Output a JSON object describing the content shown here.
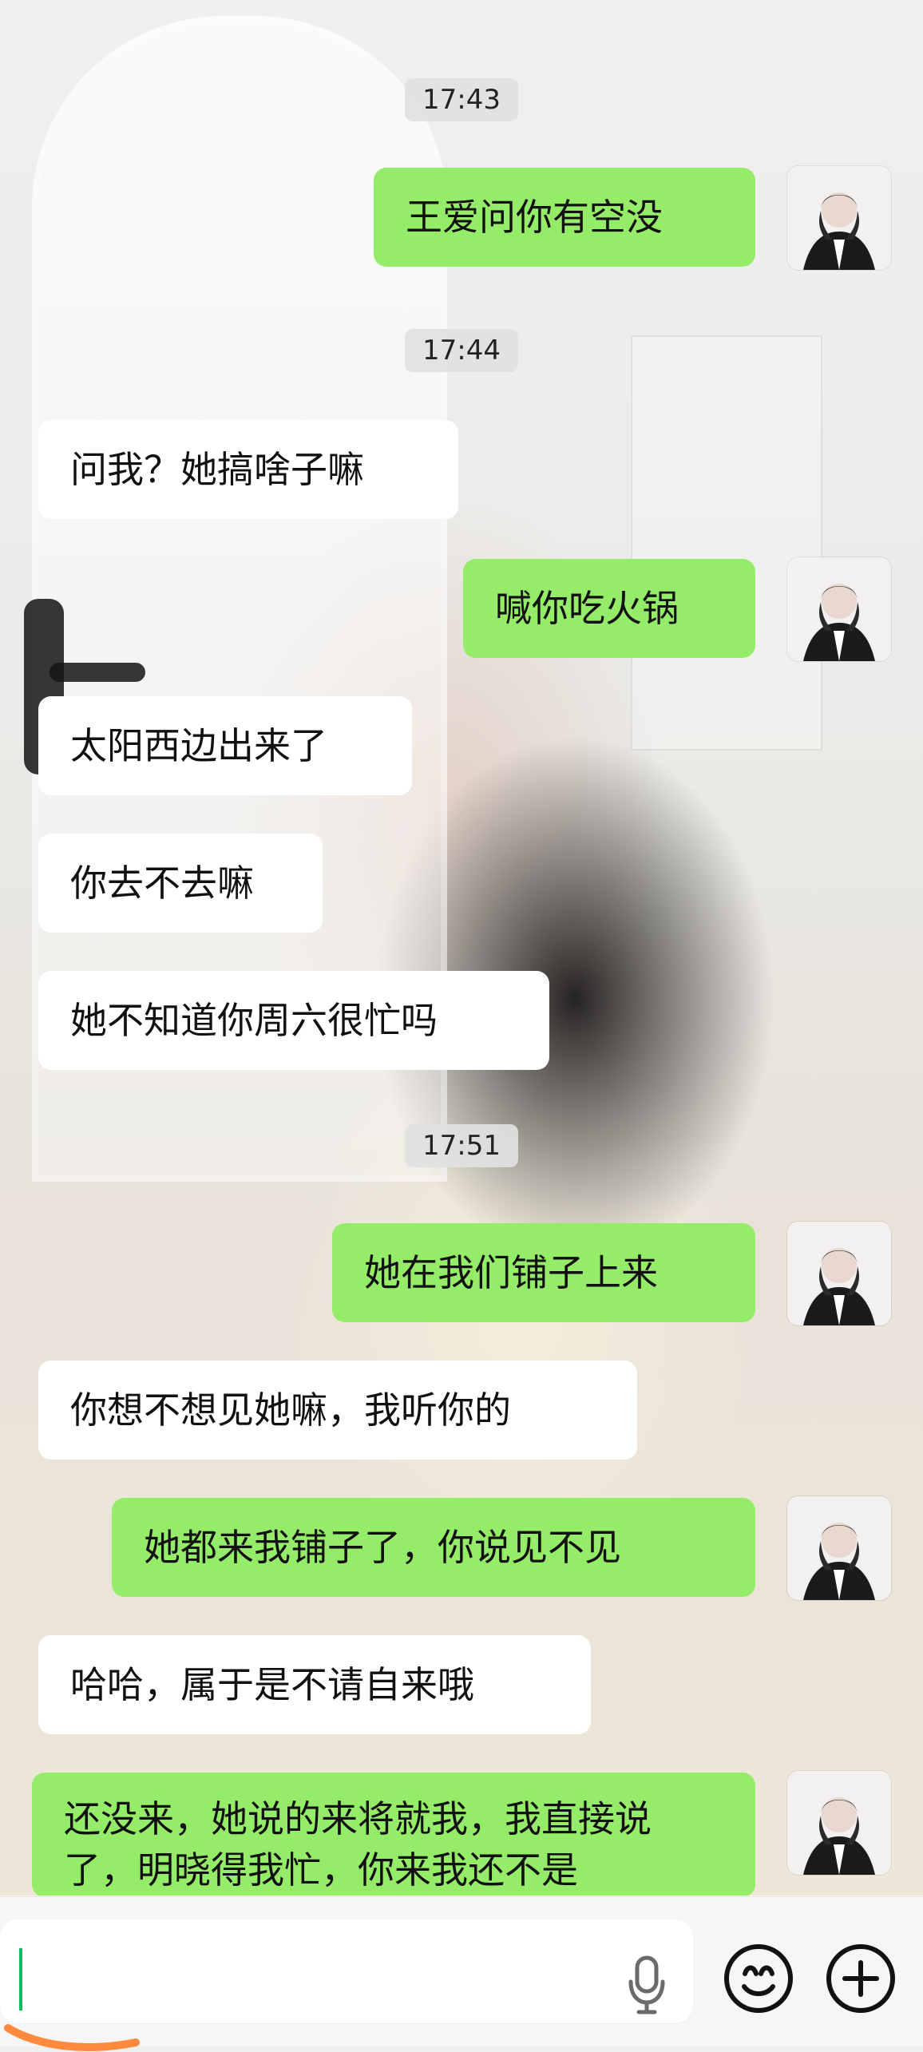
{
  "chat": {
    "timestamps": [
      "17:43",
      "17:44",
      "17:51"
    ],
    "messages": [
      {
        "side": "right",
        "text": "王爱问你有空没"
      },
      {
        "side": "left",
        "text": "问我？她搞啥子嘛"
      },
      {
        "side": "right",
        "text": "喊你吃火锅"
      },
      {
        "side": "left",
        "text": "太阳西边出来了"
      },
      {
        "side": "left",
        "text": "你去不去嘛"
      },
      {
        "side": "left",
        "text": "她不知道你周六很忙吗"
      },
      {
        "side": "right",
        "text": "她在我们铺子上来"
      },
      {
        "side": "left",
        "text": "你想不想见她嘛，我听你的"
      },
      {
        "side": "right",
        "text": "她都来我铺子了，你说见不见"
      },
      {
        "side": "left",
        "text": "哈哈，属于是不请自来哦"
      },
      {
        "side": "right",
        "text": "还没来，她说的来将就我，我直接说了，明晓得我忙，你来我还不是"
      }
    ]
  },
  "icons": {
    "avatar": "avatar",
    "mic": "microphone-icon",
    "emoji": "emoji-icon",
    "plus": "add-icon"
  },
  "colors": {
    "right_bubble": "#95ec69",
    "left_bubble": "#ffffff",
    "timestamp_bg": "#e1e1e1",
    "caret": "#07c160"
  }
}
